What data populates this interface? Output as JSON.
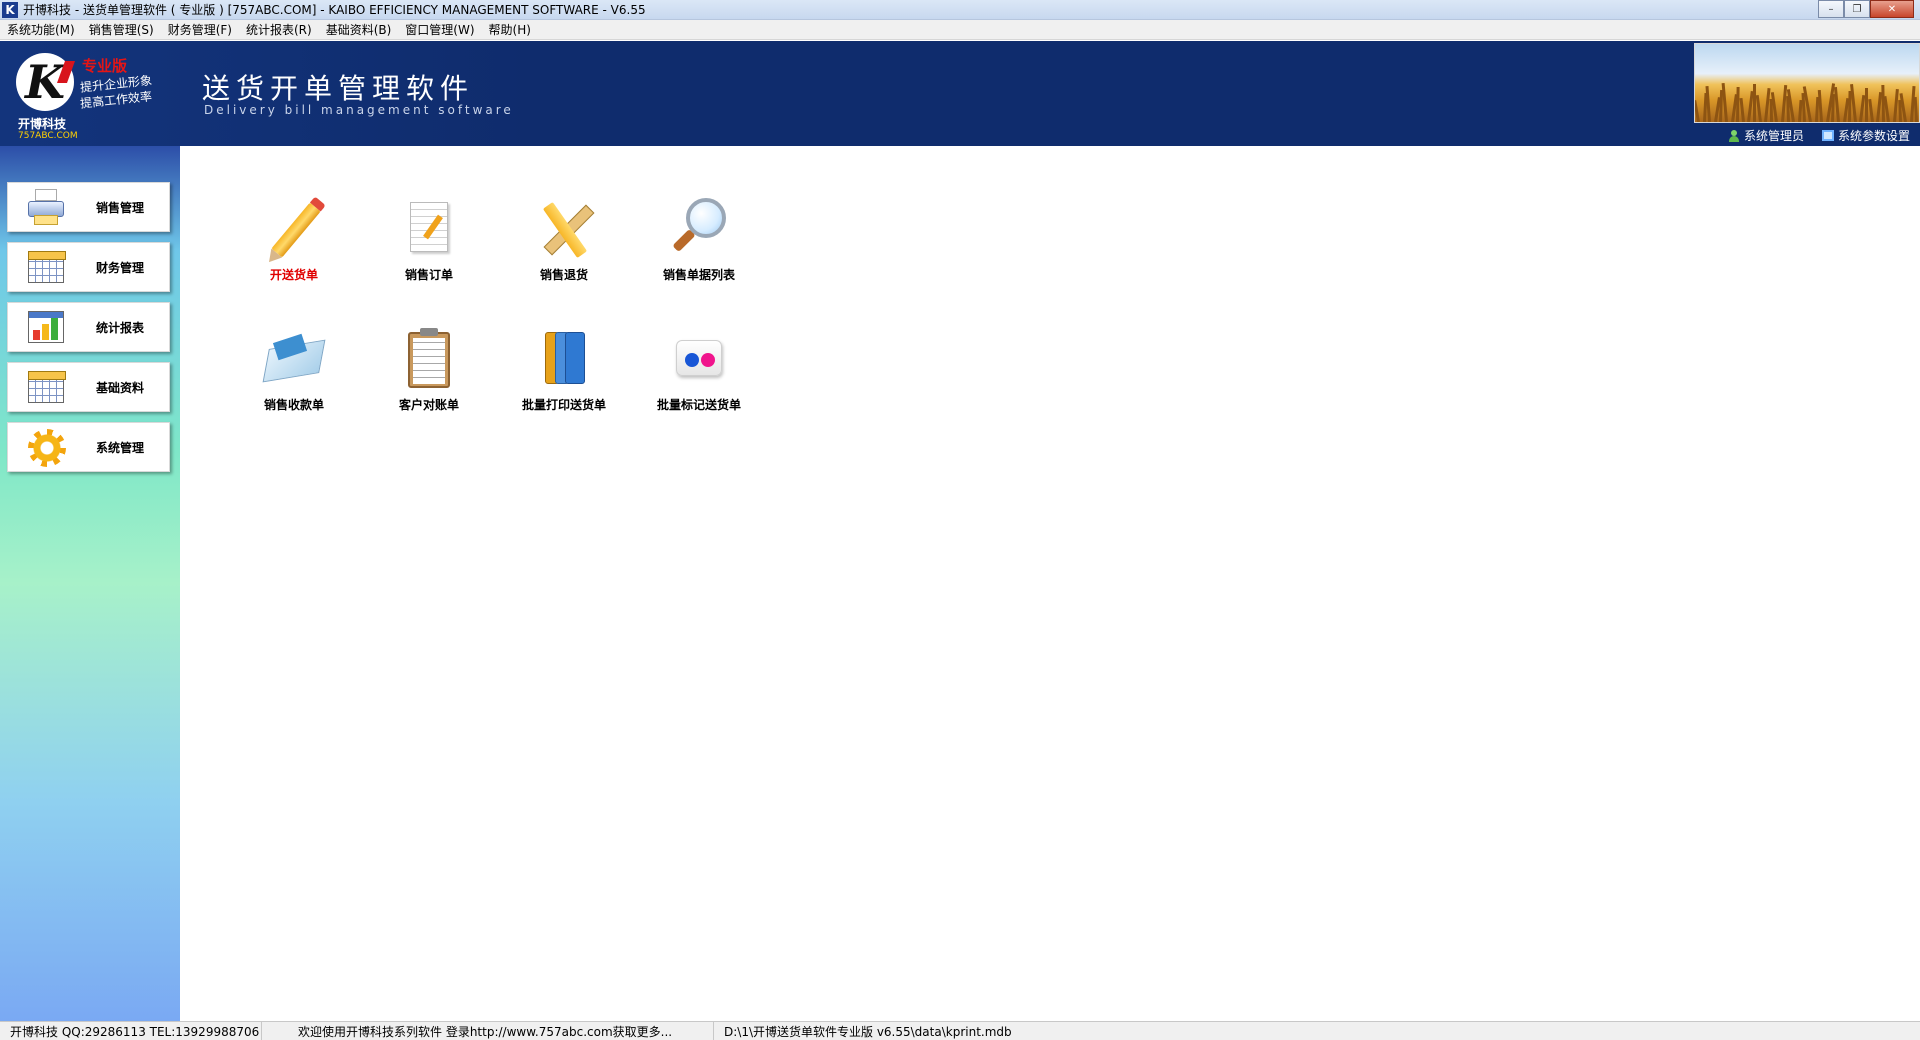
{
  "window": {
    "title": "开博科技 - 送货单管理软件 ( 专业版 ) [757ABC.COM] - KAIBO EFFICIENCY MANAGEMENT SOFTWARE - V6.55",
    "app_icon": "K",
    "minimize": "–",
    "restore": "❐",
    "close": "✕"
  },
  "menu": [
    {
      "label": "系统功能(M)"
    },
    {
      "label": "销售管理(S)"
    },
    {
      "label": "财务管理(F)"
    },
    {
      "label": "统计报表(R)"
    },
    {
      "label": "基础资料(B)"
    },
    {
      "label": "窗口管理(W)"
    },
    {
      "label": "帮助(H)"
    }
  ],
  "banner": {
    "logo_letter": "K",
    "brand_cn": "开博科技",
    "brand_url": "757ABC.COM",
    "edition": "专业版",
    "slogan_line1": "提升企业形象",
    "slogan_line2": "提高工作效率",
    "product_title": "送货开单管理软件",
    "product_subtitle": "Delivery bill management software",
    "links": [
      {
        "label": "系统管理员",
        "icon": "user-icon"
      },
      {
        "label": "系统参数设置",
        "icon": "monitor-icon"
      }
    ]
  },
  "sidebar": {
    "items": [
      {
        "label": "销售管理",
        "icon": "printer-icon"
      },
      {
        "label": "财务管理",
        "icon": "grid-calendar-icon"
      },
      {
        "label": "统计报表",
        "icon": "bar-chart-icon"
      },
      {
        "label": "基础资料",
        "icon": "grid-calendar-icon"
      },
      {
        "label": "系统管理",
        "icon": "gear-icon"
      }
    ]
  },
  "main": {
    "tiles": [
      {
        "label": "开送货单",
        "icon": "pencil-icon",
        "active": true
      },
      {
        "label": "销售订单",
        "icon": "document-pen-icon"
      },
      {
        "label": "销售退货",
        "icon": "ruler-pencil-icon"
      },
      {
        "label": "销售单据列表",
        "icon": "magnifier-icon"
      },
      {
        "label": "销售收款单",
        "icon": "card-money-icon"
      },
      {
        "label": "客户对账单",
        "icon": "clipboard-icon"
      },
      {
        "label": "批量打印送货单",
        "icon": "binders-icon"
      },
      {
        "label": "批量标记送货单",
        "icon": "dots-icon"
      }
    ]
  },
  "status": {
    "company": "开博科技 QQ:29286113 TEL:13929988706",
    "welcome": "欢迎使用开博科技系列软件    登录http://www.757abc.com获取更多...",
    "path": "D:\\1\\开博送货单软件专业版 v6.55\\data\\kprint.mdb"
  },
  "colors": {
    "banner": "#0f2c6d",
    "active_label": "#e00000"
  }
}
